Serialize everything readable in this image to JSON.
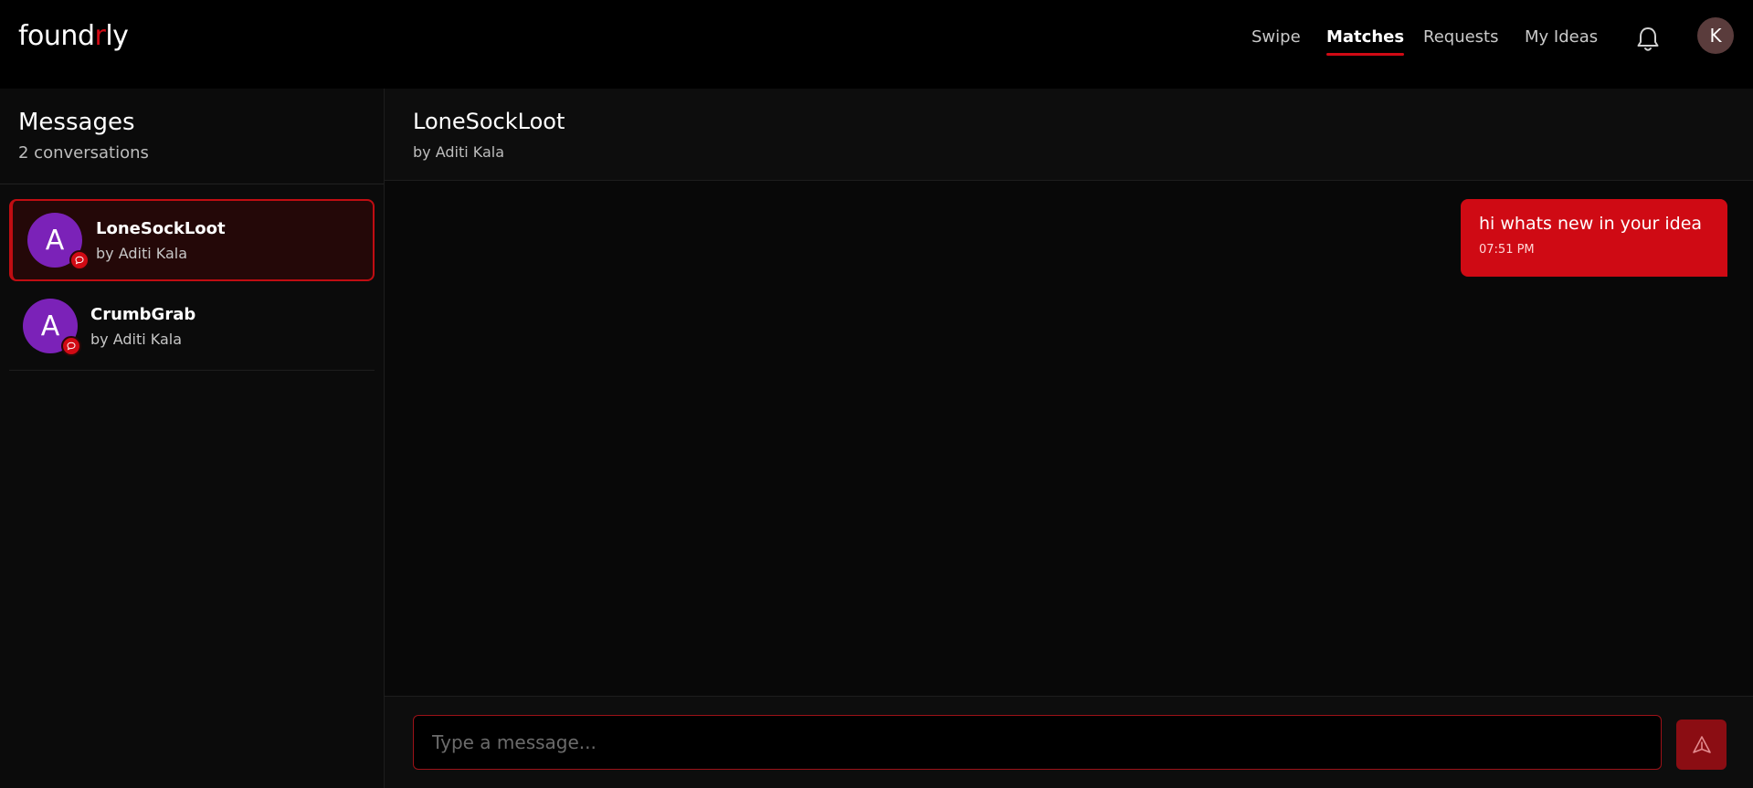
{
  "app": {
    "logo_prefix": "found",
    "logo_accent": "r",
    "logo_suffix": "ly"
  },
  "nav": {
    "items": [
      {
        "label": "Swipe",
        "active": false
      },
      {
        "label": "Matches",
        "active": true
      },
      {
        "label": "Requests",
        "active": false
      },
      {
        "label": "My Ideas",
        "active": false
      }
    ],
    "notification_icon": "bell-icon",
    "user_initial": "K"
  },
  "sidebar": {
    "title": "Messages",
    "subtitle": "2 conversations",
    "conversations": [
      {
        "initial": "A",
        "name": "LoneSockLoot",
        "author": "by Aditi Kala",
        "active": true,
        "badge_icon": "chat-bubble-icon"
      },
      {
        "initial": "A",
        "name": "CrumbGrab",
        "author": "by Aditi Kala",
        "active": false,
        "badge_icon": "chat-bubble-icon"
      }
    ]
  },
  "chat": {
    "title": "LoneSockLoot",
    "subtitle": "by Aditi Kala",
    "messages": [
      {
        "text": "hi whats new in your idea",
        "time": "07:51 PM",
        "outgoing": true
      }
    ],
    "composer": {
      "placeholder": "Type a message...",
      "value": "",
      "send_icon": "send-icon"
    }
  },
  "colors": {
    "accent": "#d10a14",
    "avatar": "#7b22b8",
    "background": "#000000"
  }
}
